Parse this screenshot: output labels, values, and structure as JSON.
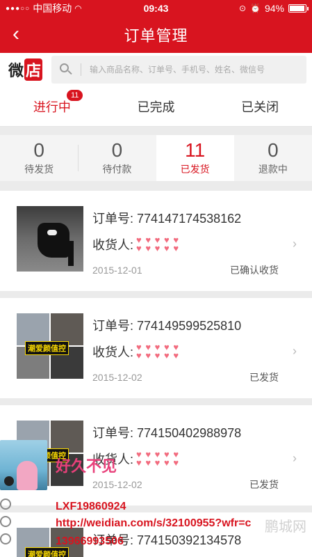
{
  "status_bar": {
    "carrier": "中国移动",
    "time": "09:43",
    "battery": "94%",
    "battery_level": 0.94
  },
  "nav": {
    "title": "订单管理",
    "back": "‹"
  },
  "logo": {
    "left": "微",
    "right": "店"
  },
  "search": {
    "placeholder": "输入商品名称、订单号、手机号、姓名、微信号"
  },
  "tabs": [
    {
      "label": "进行中",
      "badge": "11",
      "active": true
    },
    {
      "label": "已完成"
    },
    {
      "label": "已关闭"
    }
  ],
  "subtabs": [
    {
      "count": "0",
      "label": "待发货"
    },
    {
      "count": "0",
      "label": "待付款"
    },
    {
      "count": "11",
      "label": "已发货",
      "active": true
    },
    {
      "count": "0",
      "label": "退款中"
    }
  ],
  "orders": [
    {
      "order_label": "订单号:",
      "order_no": "774147174538162",
      "receiver_label": "收货人:",
      "date": "2015-12-01",
      "status": "已确认收货"
    },
    {
      "order_label": "订单号:",
      "order_no": "774149599525810",
      "receiver_label": "收货人:",
      "date": "2015-12-02",
      "status": "已发货",
      "thumb_tag": "潮爱颜值控"
    },
    {
      "order_label": "订单号:",
      "order_no": "774150402988978",
      "receiver_label": "收货人:",
      "date": "2015-12-02",
      "status": "已发货",
      "thumb_tag": "潮爱颜值控"
    },
    {
      "order_label": "订单号:",
      "order_no": "774150392134578",
      "thumb_tag": "潮爱颜值控"
    }
  ],
  "watermark": {
    "greeting": "好久不见",
    "id": "LXF19860924",
    "url": "http://weidian.com/s/32100955?wfr=c",
    "phone": "13966993506",
    "site": "鹏城网"
  }
}
